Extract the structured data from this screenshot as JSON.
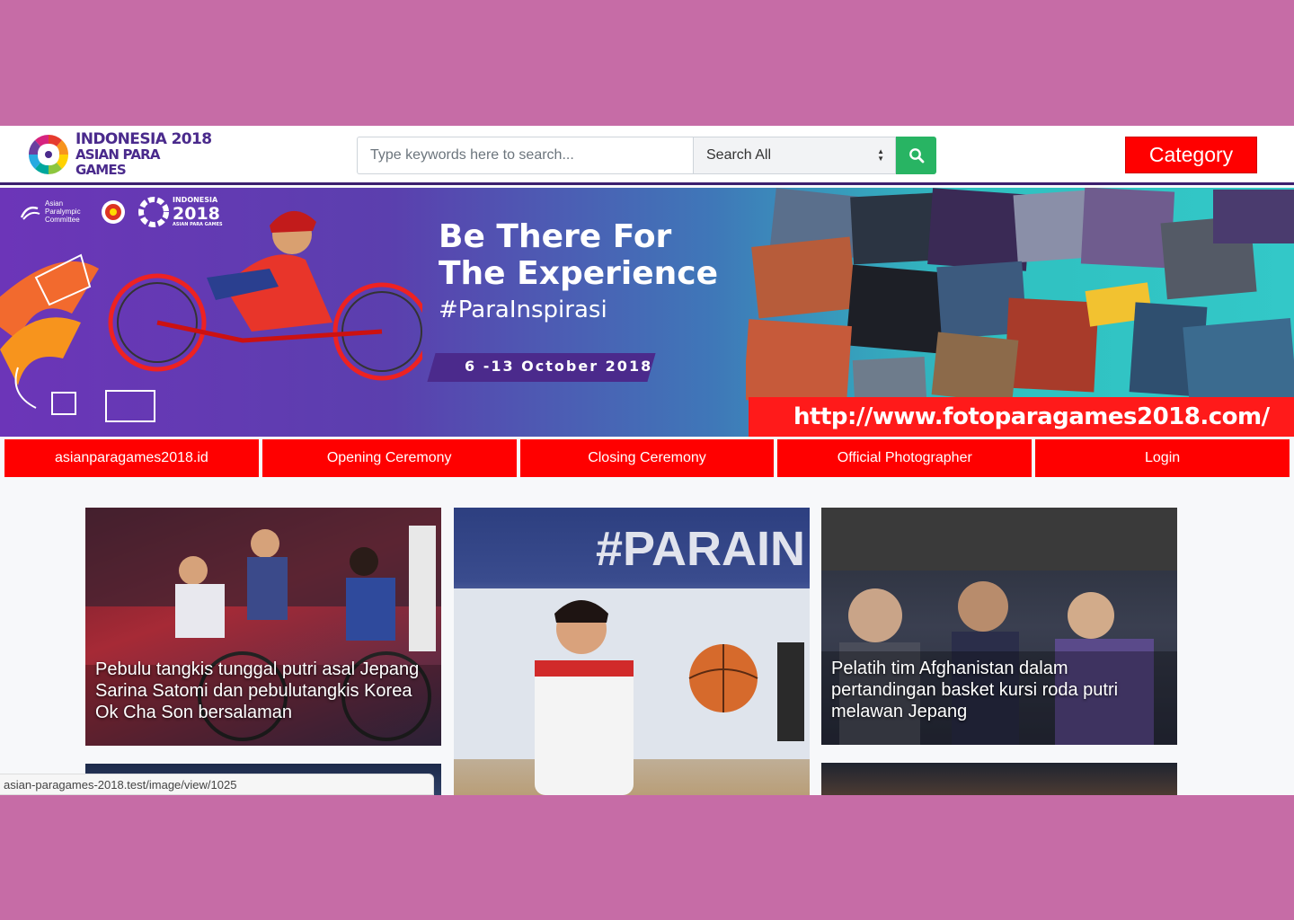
{
  "header": {
    "logo": {
      "line1": "INDONESIA 2018",
      "line2": "ASIAN PARA GAMES"
    },
    "search": {
      "placeholder": "Type keywords here to search...",
      "value": ""
    },
    "search_scope": "Search All",
    "category_label": "Category"
  },
  "banner": {
    "org_label": "Asian Paralympic Committee",
    "event_logo": {
      "line1": "INDONESIA",
      "line2": "2018",
      "line3": "ASIAN PARA GAMES"
    },
    "headline_1": "Be There For",
    "headline_2": "The Experience",
    "hashtag": "#ParaInspirasi",
    "dates": "6 -13 October 2018",
    "url": "http://www.fotoparagames2018.com/"
  },
  "nav": [
    {
      "label": "asianparagames2018.id"
    },
    {
      "label": "Opening Ceremony"
    },
    {
      "label": "Closing Ceremony"
    },
    {
      "label": "Official Photographer"
    },
    {
      "label": "Login"
    }
  ],
  "cards": [
    {
      "caption": "Pebulu tangkis tunggal putri asal Jepang Sarina Satomi dan pebulutangkis Korea Ok Cha Son bersalaman"
    },
    {
      "caption": ""
    },
    {
      "caption": "Pelatih tim Afghanistan dalam pertandingan basket kursi roda putri melawan Jepang"
    }
  ],
  "status_url": "asian-paragames-2018.test/image/view/1025",
  "colors": {
    "accent_red": "#ff0000",
    "search_green": "#28b463",
    "brand_purple": "#4a2a8c",
    "backdrop": "#c66ca6"
  }
}
